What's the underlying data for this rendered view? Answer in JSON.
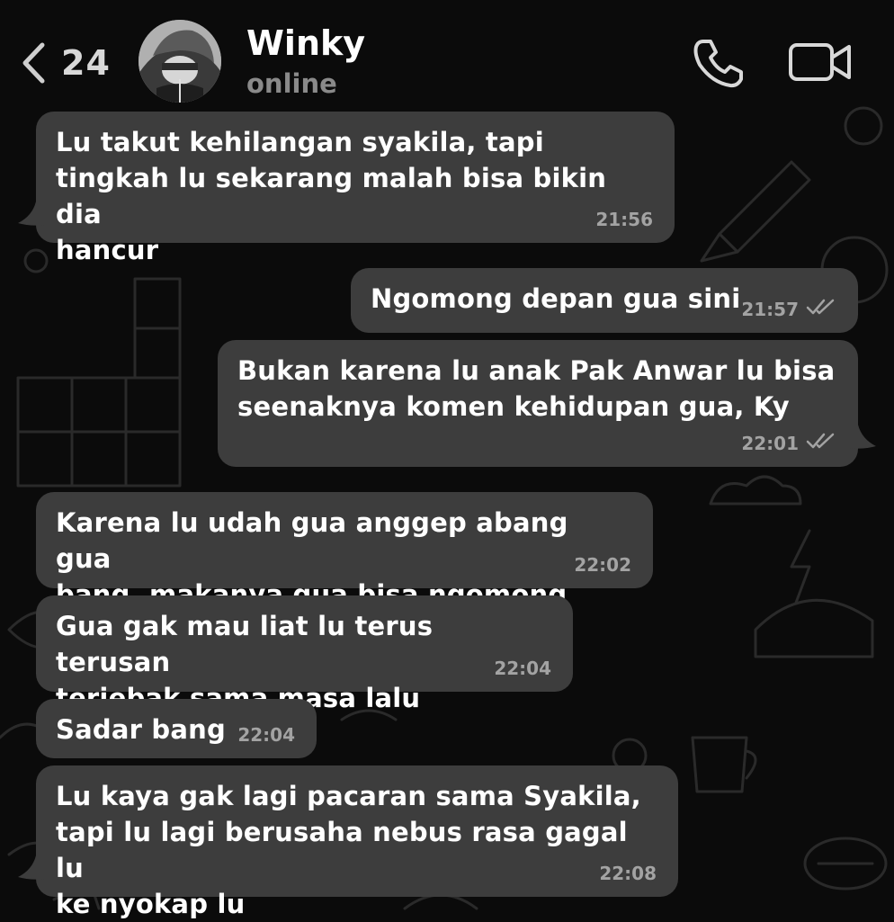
{
  "header": {
    "back_count": "24",
    "back_icon": "chevron-left-icon",
    "contact_name": "Winky",
    "contact_status": "online",
    "call_icon": "phone-icon",
    "video_icon": "video-camera-icon"
  },
  "theme": {
    "background": "#0b0b0b",
    "bubble": "#3d3d3d",
    "text": "#ffffff",
    "meta": "#a3a3a3"
  },
  "messages": [
    {
      "direction": "incoming",
      "text": "Lu takut kehilangan syakila, tapi\ntingkah lu sekarang malah bisa bikin dia\nhancur",
      "time": "21:56"
    },
    {
      "direction": "outgoing",
      "text": "Ngomong depan gua sini",
      "time": "21:57",
      "status": "read"
    },
    {
      "direction": "outgoing",
      "text": "Bukan karena lu anak Pak Anwar lu bisa\nseenaknya komen kehidupan gua, Ky",
      "time": "22:01",
      "status": "read"
    },
    {
      "direction": "incoming",
      "text": "Karena lu udah gua anggep abang gua\nbang, makanya gua bisa ngomong",
      "time": "22:02"
    },
    {
      "direction": "incoming",
      "text": "Gua gak mau liat lu terus terusan\nterjebak sama masa lalu",
      "time": "22:04"
    },
    {
      "direction": "incoming",
      "text": "Sadar bang",
      "time": "22:04"
    },
    {
      "direction": "incoming",
      "text": "Lu kaya gak lagi pacaran sama Syakila,\ntapi lu lagi berusaha nebus rasa gagal lu\nke nyokap lu",
      "time": "22:08"
    }
  ]
}
